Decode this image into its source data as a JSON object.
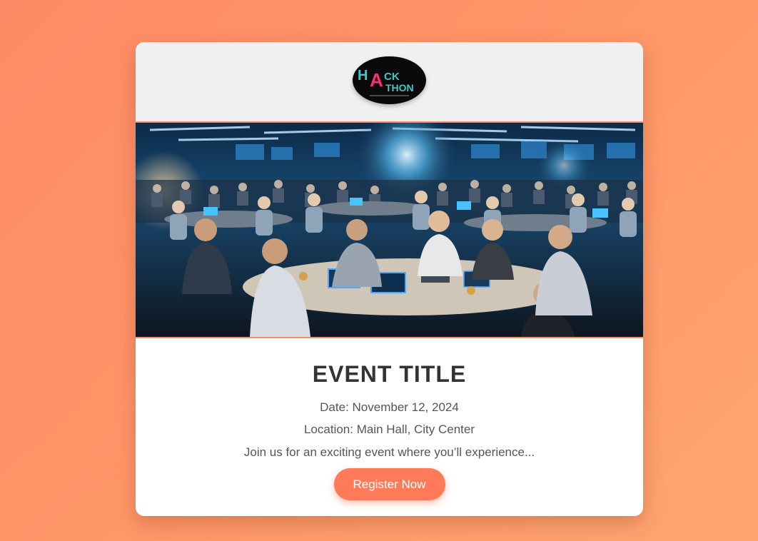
{
  "logo": {
    "line1": "HACK",
    "line2": "ATHON",
    "icon": "hackathon-logo"
  },
  "hero": {
    "icon": "hackathon-photo"
  },
  "event": {
    "title": "EVENT TITLE",
    "date": "Date: November 12, 2024",
    "location": "Location: Main Hall, City Center",
    "description": "Join us for an exciting event where you’ll experience..."
  },
  "register_button": {
    "label": "Register Now"
  },
  "colors": {
    "background": "#ff8a65",
    "card": "#ffffff",
    "header": "#f0f0f0",
    "accent": "#ff7a59",
    "title": "#333333",
    "text": "#555555",
    "logo_pink": "#ff2d6f",
    "logo_teal": "#3cc8c8"
  }
}
